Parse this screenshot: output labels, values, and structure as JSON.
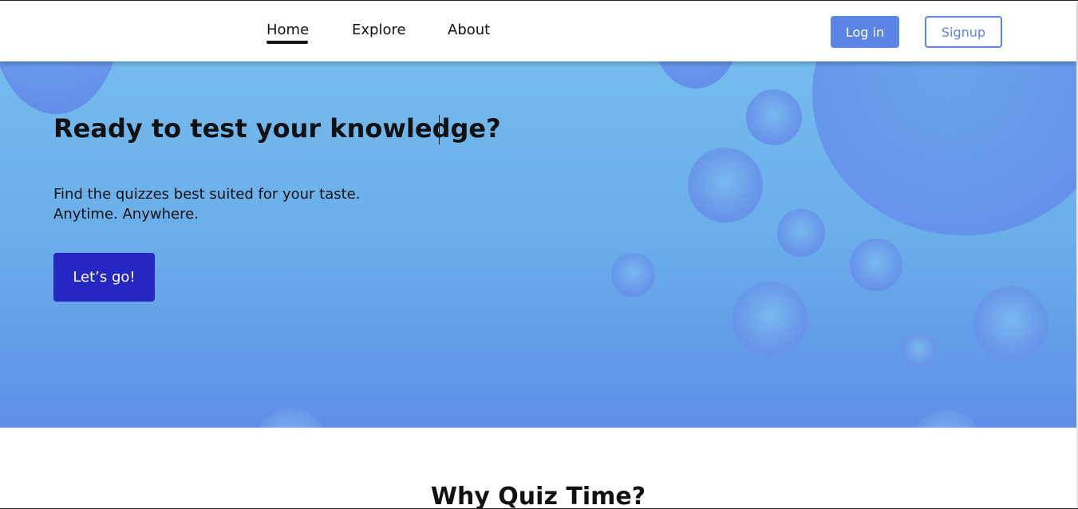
{
  "nav": {
    "links": [
      "Home",
      "Explore",
      "About"
    ],
    "active": "Home",
    "login_label": "Log in",
    "signup_label": "Signup"
  },
  "hero": {
    "title": "Ready to test your knowledge?",
    "subtitle_line1": "Find the quizzes best suited for your taste.",
    "subtitle_line2": "Anytime. Anywhere.",
    "cta_label": "Let’s go!"
  },
  "section": {
    "title": "Why Quiz Time?"
  },
  "colors": {
    "primary_button": "#5b84e8",
    "cta_button": "#2427c4",
    "hero_top": "#78c0ef",
    "hero_bottom": "#5e8fe8"
  }
}
